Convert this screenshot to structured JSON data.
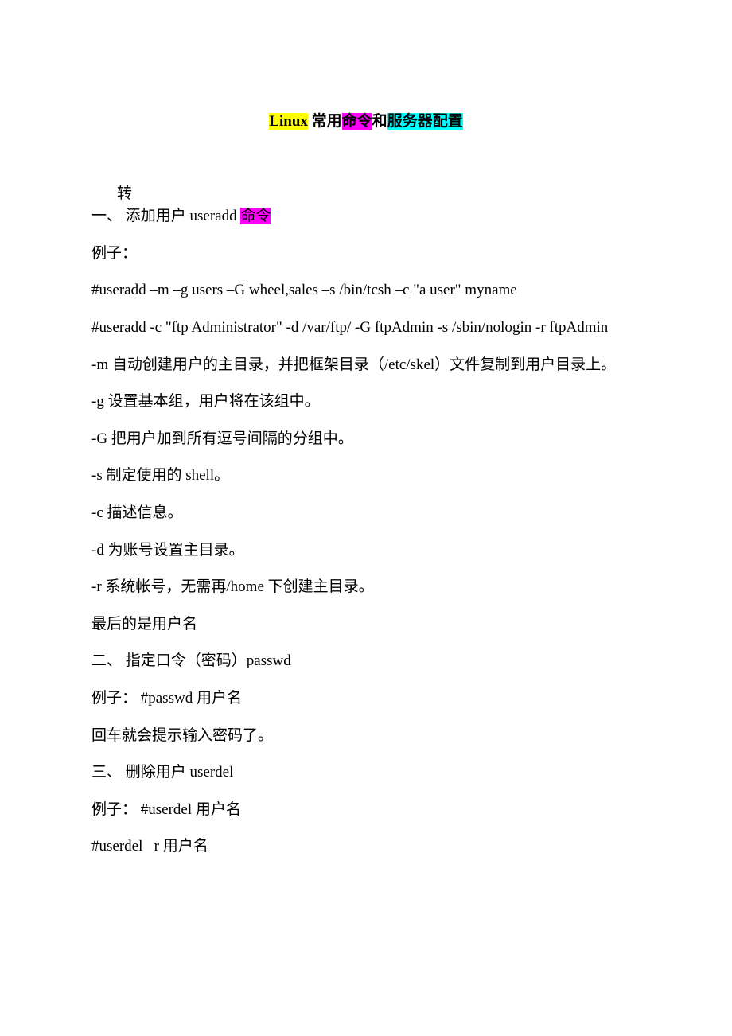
{
  "title": {
    "part1": "Linux",
    "part2": " 常用",
    "part3": "命令",
    "part4": "和",
    "part5": "服务器配置"
  },
  "indent": "转",
  "heading1_prefix": "一、 添加用户 useradd ",
  "heading1_hl": "命令",
  "p1": "例子：",
  "p2": "#useradd –m –g users –G wheel,sales –s /bin/tcsh –c \"a user\" myname",
  "p3": "#useradd -c \"ftp Administrator\" -d /var/ftp/ -G ftpAdmin -s /sbin/nologin -r ftpAdmin",
  "p4": "-m 自动创建用户的主目录，并把框架目录（/etc/skel）文件复制到用户目录上。",
  "p5": "-g 设置基本组，用户将在该组中。",
  "p6": "-G 把用户加到所有逗号间隔的分组中。",
  "p7": "-s 制定使用的 shell。",
  "p8": "-c 描述信息。",
  "p9": "-d 为账号设置主目录。",
  "p10": "-r 系统帐号，无需再/home 下创建主目录。",
  "p11": "最后的是用户名",
  "p12": "二、 指定口令（密码）passwd",
  "p13": "例子： #passwd 用户名",
  "p14": "回车就会提示输入密码了。",
  "p15": "三、 删除用户 userdel",
  "p16": "例子： #userdel 用户名",
  "p17": "#userdel –r 用户名"
}
